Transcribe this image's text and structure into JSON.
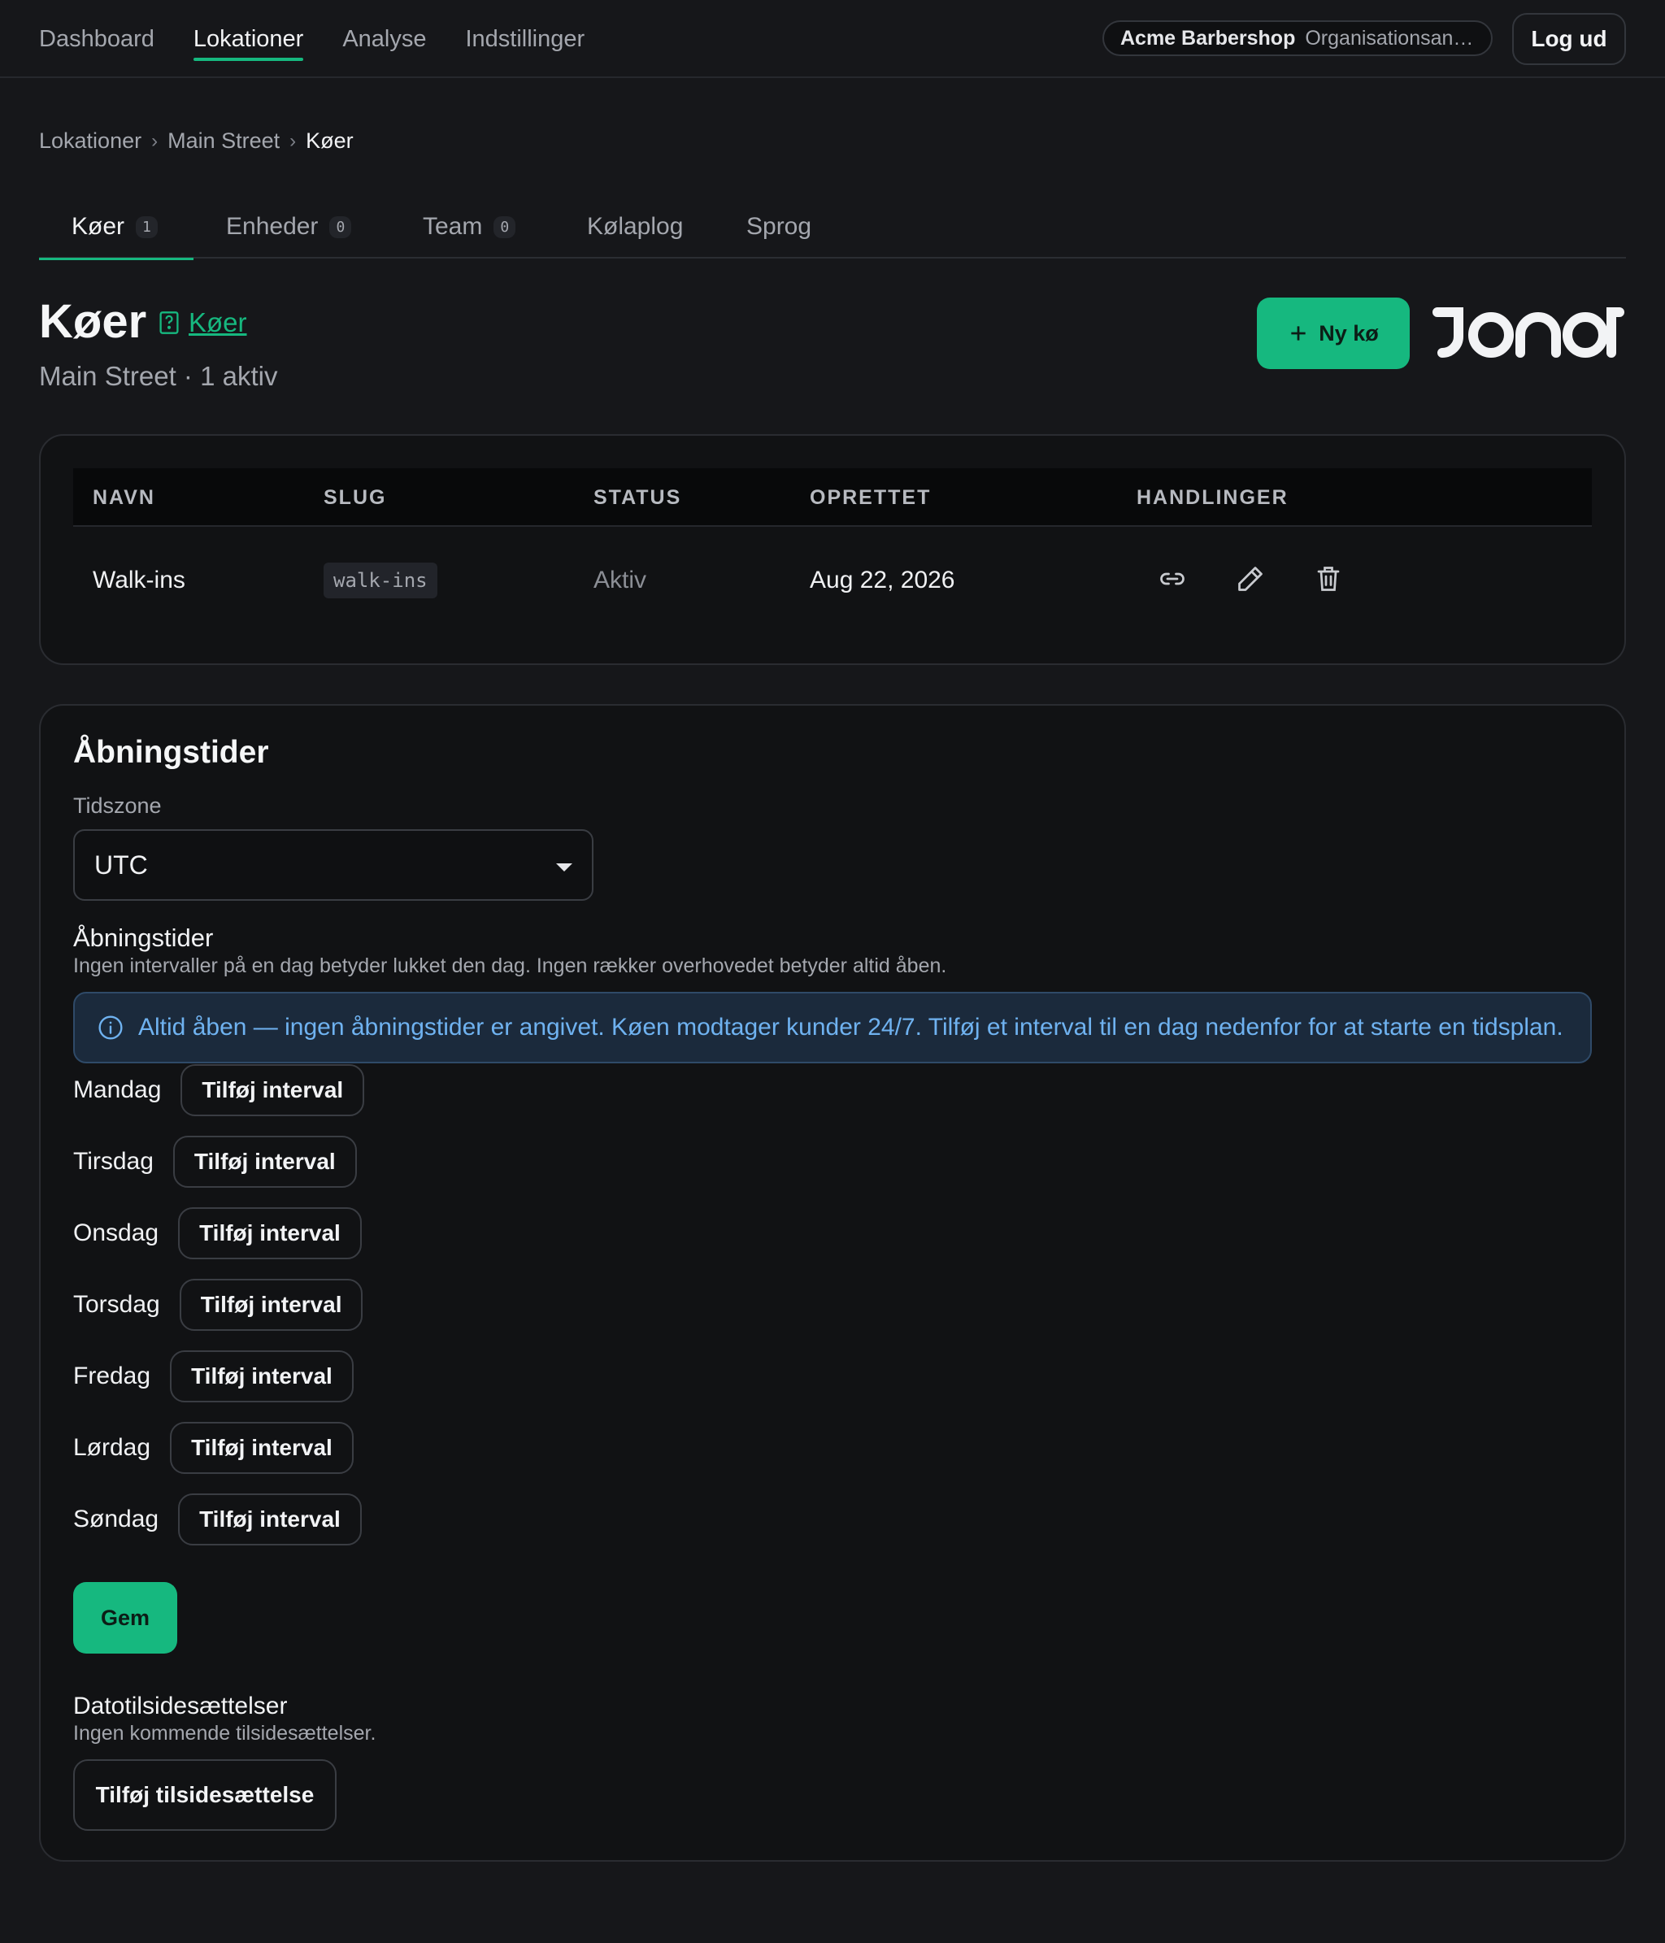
{
  "topnav": {
    "items": [
      "Dashboard",
      "Lokationer",
      "Analyse",
      "Indstillinger"
    ],
    "active": "Lokationer",
    "org_name": "Acme Barbershop",
    "org_role": "Organisationsans...",
    "logout_label": "Log ud"
  },
  "breadcrumb": [
    "Lokationer",
    "Main Street",
    "Køer"
  ],
  "tabs": [
    {
      "label": "Køer",
      "count": "1"
    },
    {
      "label": "Enheder",
      "count": "0"
    },
    {
      "label": "Team",
      "count": "0"
    },
    {
      "label": "Kølaplog"
    },
    {
      "label": "Sprog"
    }
  ],
  "header": {
    "title": "Køer",
    "doc_link": "Køer",
    "subtitle": "Main Street · 1 aktiv",
    "new_button": "Ny kø",
    "logo_text": "JONOT"
  },
  "table": {
    "columns": [
      "NAVN",
      "SLUG",
      "STATUS",
      "OPRETTET",
      "HANDLINGER"
    ],
    "rows": [
      {
        "name": "Walk-ins",
        "slug": "walk-ins",
        "status": "Aktiv",
        "created": "Aug 22, 2026"
      }
    ]
  },
  "hours": {
    "title": "Åbningstider",
    "timezone_label": "Tidszone",
    "timezone_value": "UTC",
    "hours_label": "Åbningstider",
    "hint": "Ingen intervaller på en dag betyder lukket den dag. Ingen rækker overhovedet betyder altid åben.",
    "alert": "Altid åben — ingen åbningstider er angivet. Køen modtager kunder 24/7. Tilføj et interval til en dag nedenfor for at starte en tidsplan.",
    "days": [
      "Mandag",
      "Tirsdag",
      "Onsdag",
      "Torsdag",
      "Fredag",
      "Lørdag",
      "Søndag"
    ],
    "add_interval_label": "Tilføj interval",
    "save_label": "Gem"
  },
  "overrides": {
    "title": "Datotilsidesættelser",
    "hint": "Ingen kommende tilsidesættelser.",
    "add_label": "Tilføj tilsidesættelse"
  },
  "colors": {
    "accent": "#16b87f",
    "background": "#16171a",
    "card": "#111214",
    "alert_text": "#6fb2f0"
  },
  "icons": [
    "doc-icon",
    "plus-icon",
    "link-icon",
    "edit-icon",
    "trash-icon",
    "info-icon",
    "chevron-down-icon"
  ]
}
